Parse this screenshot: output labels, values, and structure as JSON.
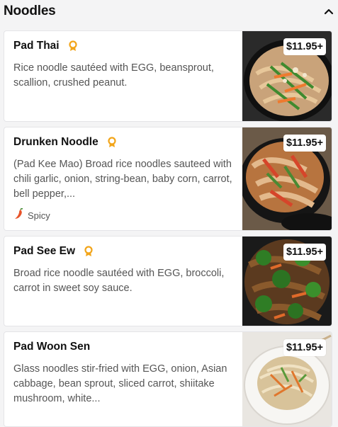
{
  "section": {
    "title": "Noodles",
    "collapse_icon": "chevron-up-icon"
  },
  "items": [
    {
      "name": "Pad Thai",
      "badge_icon": "award-ribbon-icon",
      "description": "Rice noodle sautéed with EGG, beansprout, scallion, crushed peanut.",
      "price": "$11.95+"
    },
    {
      "name": "Drunken Noodle",
      "badge_icon": "award-ribbon-icon",
      "description": "(Pad Kee Mao) Broad rice noodles sauteed with chili garlic, onion, string-bean, baby corn, carrot, bell pepper,...",
      "tag": {
        "icon": "chili-pepper-icon",
        "label": "Spicy"
      },
      "price": "$11.95+"
    },
    {
      "name": "Pad See Ew",
      "badge_icon": "award-ribbon-icon",
      "description": "Broad rice noodle sautéed with EGG, broccoli, carrot in sweet soy sauce.",
      "price": "$11.95+"
    },
    {
      "name": "Pad Woon Sen",
      "description": "Glass noodles stir-fried with EGG, onion, Asian cabbage, bean sprout, sliced carrot, shiitake mushroom, white...",
      "price": "$11.95+"
    }
  ],
  "colors": {
    "badge": "#f2a51a",
    "chili": "#e8542a",
    "background": "#f4f4f5"
  }
}
